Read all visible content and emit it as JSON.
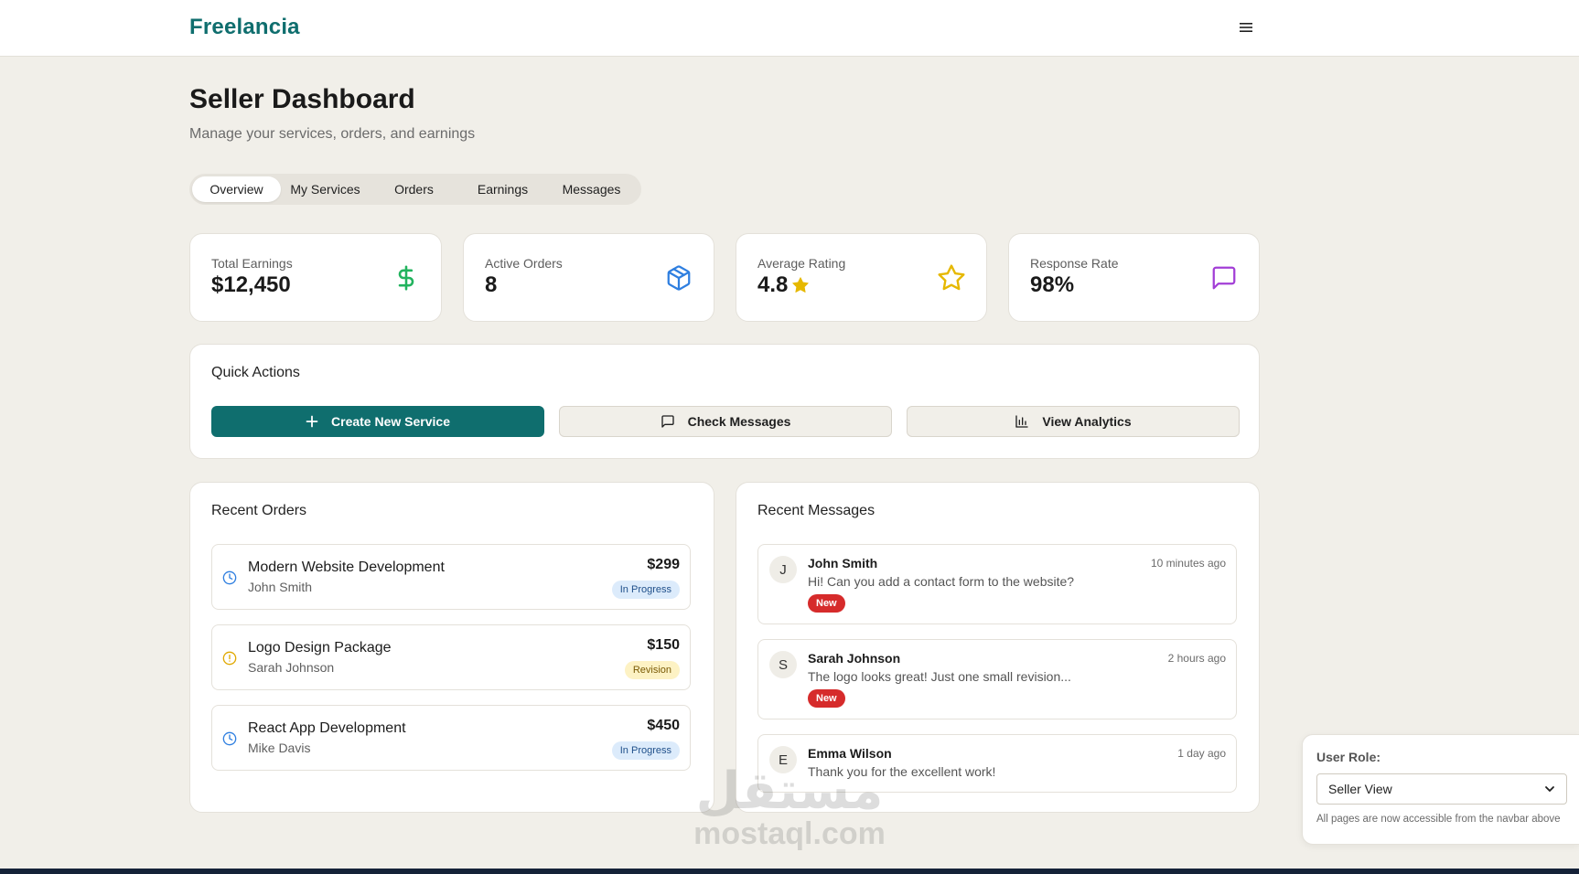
{
  "navbar": {
    "brand": "Freelancia",
    "menu_icon": "hamburger-icon"
  },
  "header": {
    "title": "Seller Dashboard",
    "subtitle": "Manage your services, orders, and earnings"
  },
  "tabs": [
    {
      "label": "Overview",
      "active": true
    },
    {
      "label": "My Services",
      "active": false
    },
    {
      "label": "Orders",
      "active": false
    },
    {
      "label": "Earnings",
      "active": false
    },
    {
      "label": "Messages",
      "active": false
    }
  ],
  "stats": [
    {
      "label": "Total Earnings",
      "value": "$12,450",
      "icon": "dollar-icon",
      "color": "#22b35e"
    },
    {
      "label": "Active Orders",
      "value": "8",
      "icon": "package-icon",
      "color": "#2f7fe0"
    },
    {
      "label": "Average Rating",
      "value": "4.8",
      "icon": "star-icon",
      "color": "#e6b800"
    },
    {
      "label": "Response Rate",
      "value": "98%",
      "icon": "message-icon",
      "color": "#a23ed6"
    }
  ],
  "quick_actions": {
    "title": "Quick Actions",
    "buttons": [
      {
        "label": "Create New Service",
        "icon": "plus-icon"
      },
      {
        "label": "Check Messages",
        "icon": "message-icon"
      },
      {
        "label": "View Analytics",
        "icon": "bar-chart-icon"
      }
    ]
  },
  "recent_orders": {
    "title": "Recent Orders",
    "items": [
      {
        "title": "Modern Website Development",
        "client": "John Smith",
        "price": "$299",
        "status": "In Progress",
        "icon": "clock-icon"
      },
      {
        "title": "Logo Design Package",
        "client": "Sarah Johnson",
        "price": "$150",
        "status": "Revision",
        "icon": "alert-circle-icon"
      },
      {
        "title": "React App Development",
        "client": "Mike Davis",
        "price": "$450",
        "status": "In Progress",
        "icon": "clock-icon"
      }
    ]
  },
  "recent_messages": {
    "title": "Recent Messages",
    "items": [
      {
        "initial": "J",
        "sender": "John Smith",
        "time": "10 minutes ago",
        "text": "Hi! Can you add a contact form to the website?",
        "badge": "New"
      },
      {
        "initial": "S",
        "sender": "Sarah Johnson",
        "time": "2 hours ago",
        "text": "The logo looks great! Just one small revision...",
        "badge": "New"
      },
      {
        "initial": "E",
        "sender": "Emma Wilson",
        "time": "1 day ago",
        "text": "Thank you for the excellent work!",
        "badge": ""
      }
    ]
  },
  "role_panel": {
    "label": "User Role:",
    "selected": "Seller View",
    "note": "All pages are now accessible from the navbar above"
  },
  "watermark": {
    "arabic": "مستقل",
    "latin": "mostaql.com"
  }
}
